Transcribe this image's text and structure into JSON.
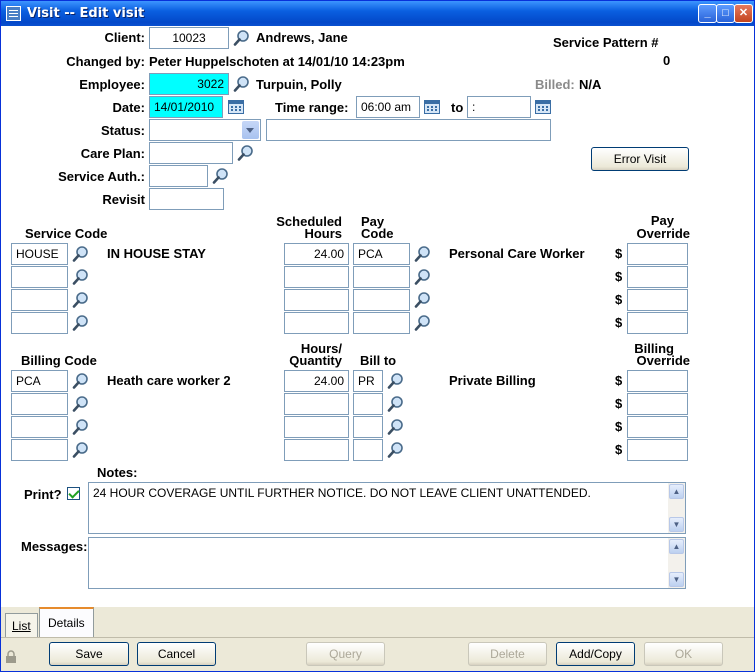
{
  "window": {
    "title": "Visit  -- Edit visit",
    "minimize": "_",
    "maximize": "□",
    "close": "✕"
  },
  "header": {
    "client_label": "Client:",
    "client_id": "10023",
    "client_name": "Andrews, Jane",
    "changed_by_label": "Changed by:",
    "changed_by_value": "Peter Huppelschoten at 14/01/10 14:23pm",
    "service_pattern_label": "Service Pattern #",
    "service_pattern_value": "0",
    "employee_label": "Employee:",
    "employee_id": "3022",
    "employee_name": "Turpuin, Polly",
    "billed_label": "Billed:",
    "billed_value": "N/A",
    "date_label": "Date:",
    "date_value": "14/01/2010",
    "time_range_label": "Time range:",
    "time_from": "06:00 am",
    "to_label": "to",
    "time_to": ":",
    "status_label": "Status:",
    "status_value": "",
    "status_desc": "",
    "care_plan_label": "Care Plan:",
    "care_plan_value": "",
    "service_auth_label": "Service Auth.:",
    "service_auth_value": "",
    "revisit_label": "Revisit",
    "revisit_value": "",
    "error_visit_button": "Error Visit"
  },
  "service": {
    "code_header": "Service Code",
    "scheduled_header_1": "Scheduled",
    "scheduled_header_2": "Hours",
    "pay_code_header_1": "Pay",
    "pay_code_header_2": "Code",
    "pay_override_header_1": "Pay",
    "pay_override_header_2": "Override",
    "currency": "$",
    "rows": [
      {
        "code": "HOUSE",
        "desc": "IN HOUSE STAY",
        "hours": "24.00",
        "pay_code": "PCA",
        "pay_desc": "Personal Care Worker",
        "override": ""
      },
      {
        "code": "",
        "desc": "",
        "hours": "",
        "pay_code": "",
        "pay_desc": "",
        "override": ""
      },
      {
        "code": "",
        "desc": "",
        "hours": "",
        "pay_code": "",
        "pay_desc": "",
        "override": ""
      },
      {
        "code": "",
        "desc": "",
        "hours": "",
        "pay_code": "",
        "pay_desc": "",
        "override": ""
      }
    ]
  },
  "billing": {
    "code_header": "Billing Code",
    "qty_header_1": "Hours/",
    "qty_header_2": "Quantity",
    "bill_to_header": "Bill to",
    "override_header_1": "Billing",
    "override_header_2": "Override",
    "currency": "$",
    "rows": [
      {
        "code": "PCA",
        "desc": "Heath care worker 2",
        "qty": "24.00",
        "bill_to": "PR",
        "bill_desc": "Private Billing",
        "override": ""
      },
      {
        "code": "",
        "desc": "",
        "qty": "",
        "bill_to": "",
        "bill_desc": "",
        "override": ""
      },
      {
        "code": "",
        "desc": "",
        "qty": "",
        "bill_to": "",
        "bill_desc": "",
        "override": ""
      },
      {
        "code": "",
        "desc": "",
        "qty": "",
        "bill_to": "",
        "bill_desc": "",
        "override": ""
      }
    ]
  },
  "notes": {
    "label": "Notes:",
    "print_label": "Print?",
    "print_checked": true,
    "text": "24 HOUR COVERAGE UNTIL FURTHER NOTICE.  DO NOT LEAVE CLIENT UNATTENDED.",
    "messages_label": "Messages:",
    "messages_text": ""
  },
  "tabs": [
    {
      "label": "List"
    },
    {
      "label": "Details"
    }
  ],
  "footer": {
    "save": "Save",
    "cancel": "Cancel",
    "query": "Query",
    "delete": "Delete",
    "add_copy": "Add/Copy",
    "ok": "OK"
  },
  "icons": {
    "search": "magnifier-icon",
    "calendar": "calendar-icon",
    "app": "app-window-icon"
  }
}
